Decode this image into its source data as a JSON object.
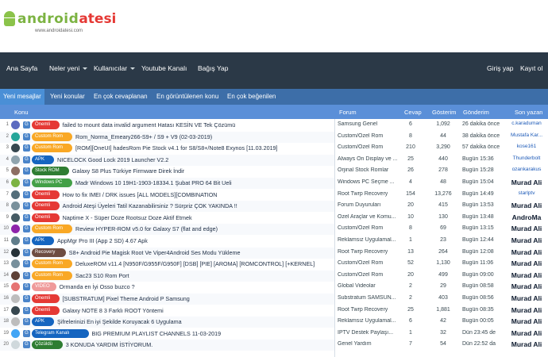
{
  "site": {
    "logo_part1": "android",
    "logo_part2": "atesi",
    "logo_url": "www.androidatesi.com"
  },
  "nav": {
    "items": [
      "Ana Sayfa",
      "Neler yeni",
      "Kullanıcılar",
      "Youtube Kanalı",
      "Bağış Yap"
    ],
    "login": "Giriş yap",
    "register": "Kayıt ol"
  },
  "tabs": [
    "Yeni mesajlar",
    "Yeni konular",
    "En çok cevaplanan",
    "En görüntülenen konu",
    "En çok beğenilen"
  ],
  "columns": {
    "topic": "Konu",
    "forum": "Forum",
    "replies": "Cevap",
    "views": "Gösterim",
    "sent": "Gönderim",
    "last_user": "Son yazan"
  },
  "colors": {
    "nav_bg": "#2b3947",
    "tabs_bg": "#3d6ea8",
    "column_header_bg": "#5a8fd8",
    "link": "#1e5bb8"
  },
  "rows": [
    {
      "num": "1",
      "badge": "Önemli",
      "badge_color": "#e53935",
      "title": "failed to mount data invalid argument Hatası KESİN VE Tek Çözümü",
      "forum": "Samsung Genel",
      "replies": "6",
      "views": "1,092",
      "sent": "26 dakika önce",
      "user": "c.karaduman",
      "avatar": "#5c6bc0",
      "big": false
    },
    {
      "num": "2",
      "badge": "Custom Rom",
      "badge_color": "#f9a825",
      "title": "Rom_Norma_Emeary266-S9+ / S9 + V9 (02-03-2019)",
      "forum": "Custom/Özel Rom",
      "replies": "8",
      "views": "44",
      "sent": "38 dakika önce",
      "user": "Mustafa Kar...",
      "avatar": "#26a69a",
      "big": false
    },
    {
      "num": "3",
      "badge": "Custom Rom",
      "badge_color": "#f9a825",
      "title": "[ROM][OneUI] hadesRom Pie Stock v4.1 for S8/S8+/Note8 Exynos [11.03.2019]",
      "forum": "Custom/Özel Rom",
      "replies": "210",
      "views": "3,290",
      "sent": "57 dakika önce",
      "user": "kose161",
      "avatar": "#37474f",
      "big": false
    },
    {
      "num": "4",
      "badge": "APK",
      "badge_color": "#1565c0",
      "title": "NICELOCK Good Lock 2019 Launcher V2.2",
      "forum": "Always On Display ve ...",
      "replies": "25",
      "views": "440",
      "sent": "Bugün 15:36",
      "user": "Thunderbolt",
      "avatar": "#90a4ae",
      "big": false
    },
    {
      "num": "5",
      "badge": "Stock ROM",
      "badge_color": "#2e7d32",
      "title": "Galaxy S8 Plus Türkiye Firmware Direk İndir",
      "forum": "Orjinal Stock Romlar",
      "replies": "26",
      "views": "278",
      "sent": "Bugün 15:28",
      "user": "ozankarakus",
      "avatar": "#8d6e63",
      "big": false
    },
    {
      "num": "6",
      "badge": "Windows PC",
      "badge_color": "#43a047",
      "title": "Madr Windows 10 19H1-1903-18334.1 Şubat PRO 64 Bit Ueli",
      "forum": "Windows PC Seçme ...",
      "replies": "4",
      "views": "48",
      "sent": "Bugün 15:04",
      "user": "Murad Ali",
      "avatar": "#7cb342",
      "big": true
    },
    {
      "num": "7",
      "badge": "Önemli",
      "badge_color": "#e53935",
      "title": "How to fix IMEI / DRK issues [ALL MODELS][COMBINATION",
      "forum": "Root Twrp Recovery",
      "replies": "154",
      "views": "13,276",
      "sent": "Bugün 14:49",
      "user": "starlptv",
      "avatar": "#546e7a",
      "big": false
    },
    {
      "num": "8",
      "badge": "Önemli",
      "badge_color": "#e53935",
      "title": "Android Ateşi Üyeleri Tatil Kazanabilirsiniz ? Sürpriz ÇOK YAKINDA !!",
      "forum": "Forum Duyuruları",
      "replies": "20",
      "views": "415",
      "sent": "Bugün 13:53",
      "user": "Murad Ali",
      "avatar": "#78909c",
      "big": true
    },
    {
      "num": "9",
      "badge": "Önemli",
      "badge_color": "#e53935",
      "title": "Naptime X - Süper Doze Rootsuz Doze Aktif Etmek",
      "forum": "Özel Araçlar ve Komu...",
      "replies": "10",
      "views": "130",
      "sent": "Bugün 13:48",
      "user": "AndroMa",
      "avatar": "#455a64",
      "big": true
    },
    {
      "num": "10",
      "badge": "Custom Rom",
      "badge_color": "#f9a825",
      "title": "Review HYPER-ROM v5.0 for Galaxy S7 (flat and edge)",
      "forum": "Custom/Özel Rom",
      "replies": "8",
      "views": "69",
      "sent": "Bugün 13:15",
      "user": "Murad Ali",
      "avatar": "#8e24aa",
      "big": true
    },
    {
      "num": "11",
      "badge": "APK",
      "badge_color": "#1565c0",
      "title": "AppMgr Pro III (App 2 SD) 4.67 Apk",
      "forum": "Reklamsız Uygulamal...",
      "replies": "1",
      "views": "23",
      "sent": "Bugün 12:44",
      "user": "Murad Ali",
      "avatar": "#607d8b",
      "big": true
    },
    {
      "num": "12",
      "badge": "Recovery",
      "badge_color": "#6d4c41",
      "title": "S8+ Android Pie Magisk Root Ve Viper4Android Ses Modu Yükleme",
      "forum": "Root Twrp Recovery",
      "replies": "13",
      "views": "264",
      "sent": "Bugün 12:08",
      "user": "Murad Ali",
      "avatar": "#263238",
      "big": true
    },
    {
      "num": "13",
      "badge": "Custom Rom",
      "badge_color": "#f9a825",
      "title": "DeluxeROM v11.4 [N950F/G955F/G950F] [DSB] [PIE] [AROMA] [ROMCONTROL] [+KERNEL]",
      "forum": "Custom/Özel Rom",
      "replies": "52",
      "views": "1,130",
      "sent": "Bugün 11:06",
      "user": "Murad Ali",
      "avatar": "#78909c",
      "big": true
    },
    {
      "num": "14",
      "badge": "Custom Rom",
      "badge_color": "#f9a825",
      "title": "Sac23 S10 Rom Port",
      "forum": "Custom/Özel Rom",
      "replies": "20",
      "views": "499",
      "sent": "Bugün 09:00",
      "user": "Murad Ali",
      "avatar": "#5d4037",
      "big": true
    },
    {
      "num": "15",
      "badge": "VIDEO",
      "badge_color": "#ef9a9a",
      "title": "Ormanda en İyi Osso buzco ?",
      "forum": "Global Videolar",
      "replies": "2",
      "views": "29",
      "sent": "Bugün 08:58",
      "user": "Murad Ali",
      "avatar": "#e57373",
      "big": true
    },
    {
      "num": "16",
      "badge": "Önemli",
      "badge_color": "#e53935",
      "title": "[SUBSTRATUM] Pixel Theme Android P Samsung",
      "forum": "Substratum SAMSUN...",
      "replies": "2",
      "views": "403",
      "sent": "Bugün 08:56",
      "user": "Murad Ali",
      "avatar": "#bdbdbd",
      "big": true
    },
    {
      "num": "17",
      "badge": "Önemli",
      "badge_color": "#e53935",
      "title": "Galaxy NOTE 8 3 Farklı ROOT Yöntemi",
      "forum": "Root Twrp Recovery",
      "replies": "25",
      "views": "1,881",
      "sent": "Bugün 08:35",
      "user": "Murad Ali",
      "avatar": "#37474f",
      "big": true
    },
    {
      "num": "18",
      "badge": "APK",
      "badge_color": "#1565c0",
      "title": "Şifrelerinizi En iyi Şekilde Koruyacak 6 Uygulama",
      "forum": "Reklamsız Uygulamal...",
      "replies": "6",
      "views": "42",
      "sent": "Bugün 00:05",
      "user": "Murad Ali",
      "avatar": "#bdbdbd",
      "big": true
    },
    {
      "num": "19",
      "badge": "Telegram Kanalı",
      "badge_color": "#1565c0",
      "title": "BIG PREMIUM PLAYLIST CHANNELS 11-03-2019",
      "forum": "IPTV Destek Paylaşı...",
      "replies": "1",
      "views": "32",
      "sent": "Dün 23:45 de",
      "user": "Murad Ali",
      "avatar": "#42a5f5",
      "big": true
    },
    {
      "num": "20",
      "badge": "Çözüldü",
      "badge_color": "#2e7d32",
      "title": "3 KONUDA YARDIM İSTİYORUM.",
      "forum": "Genel Yardım",
      "replies": "7",
      "views": "54",
      "sent": "Dün 22:52 da",
      "user": "Murad Ali",
      "avatar": "#cfd8dc",
      "big": true
    }
  ]
}
